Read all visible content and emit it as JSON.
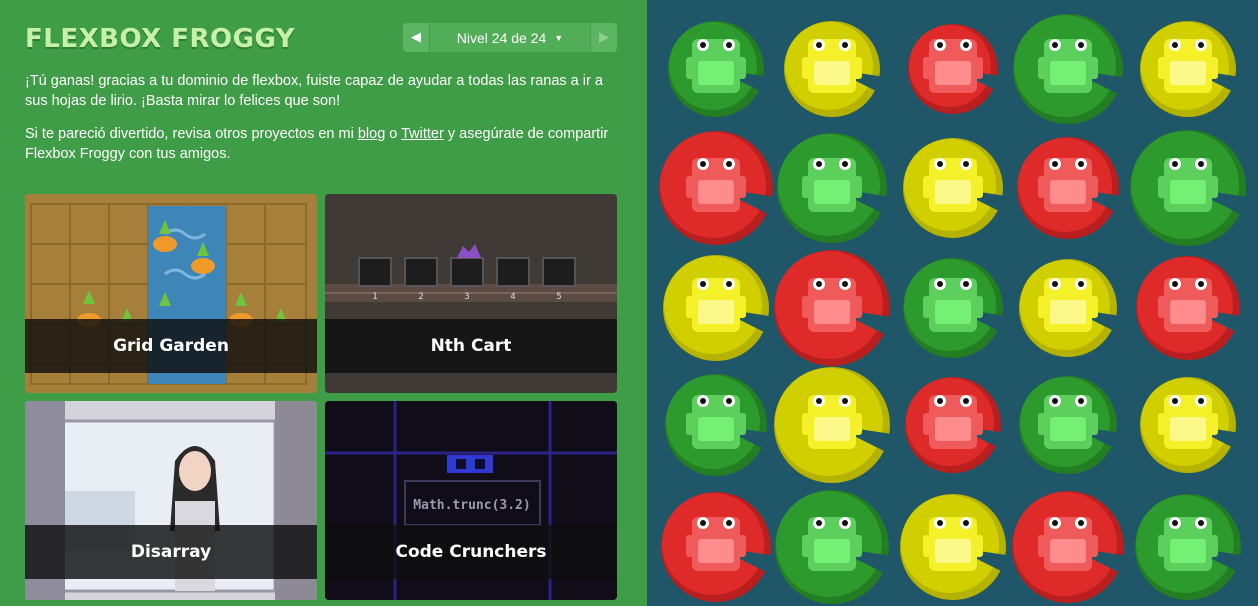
{
  "header": {
    "logo": "FLEXBOX FROGGY",
    "level_label": "Nivel 24 de 24",
    "prev_icon": "triangle-left",
    "next_icon": "triangle-right",
    "dropdown_icon": "caret-down"
  },
  "message": {
    "win_text": "¡Tú ganas! gracias a tu dominio de flexbox, fuiste capaz de ayudar a todas las ranas a ir a sus hojas de lirio. ¡Basta mirar lo felices que son!",
    "promo_before": "Si te pareció divertido, revisa otros proyectos en mi ",
    "blog_link": "blog",
    "promo_middle": " o ",
    "twitter_link": "Twitter",
    "promo_after": " y asegúrate de compartir Flexbox Froggy con tus amigos."
  },
  "projects": [
    {
      "title": "Grid Garden"
    },
    {
      "title": "Nth Cart",
      "cart_numbers": [
        "1",
        "2",
        "3",
        "4",
        "5"
      ]
    },
    {
      "title": "Disarray"
    },
    {
      "title": "Code Crunchers",
      "code_text": "Math.trunc(3.2)"
    }
  ],
  "colors": {
    "sidebar_bg": "#3f9d47",
    "board_bg": "#1f5769",
    "green": "#2e9a2e",
    "yellow": "#d8d400",
    "red": "#e02929"
  },
  "board": {
    "rows": [
      [
        "green",
        "yellow",
        "red",
        "green",
        "yellow"
      ],
      [
        "red",
        "green",
        "yellow",
        "red",
        "green"
      ],
      [
        "yellow",
        "red",
        "green",
        "yellow",
        "red"
      ],
      [
        "green",
        "yellow",
        "red",
        "green",
        "yellow"
      ],
      [
        "red",
        "green",
        "yellow",
        "red",
        "green"
      ]
    ]
  }
}
